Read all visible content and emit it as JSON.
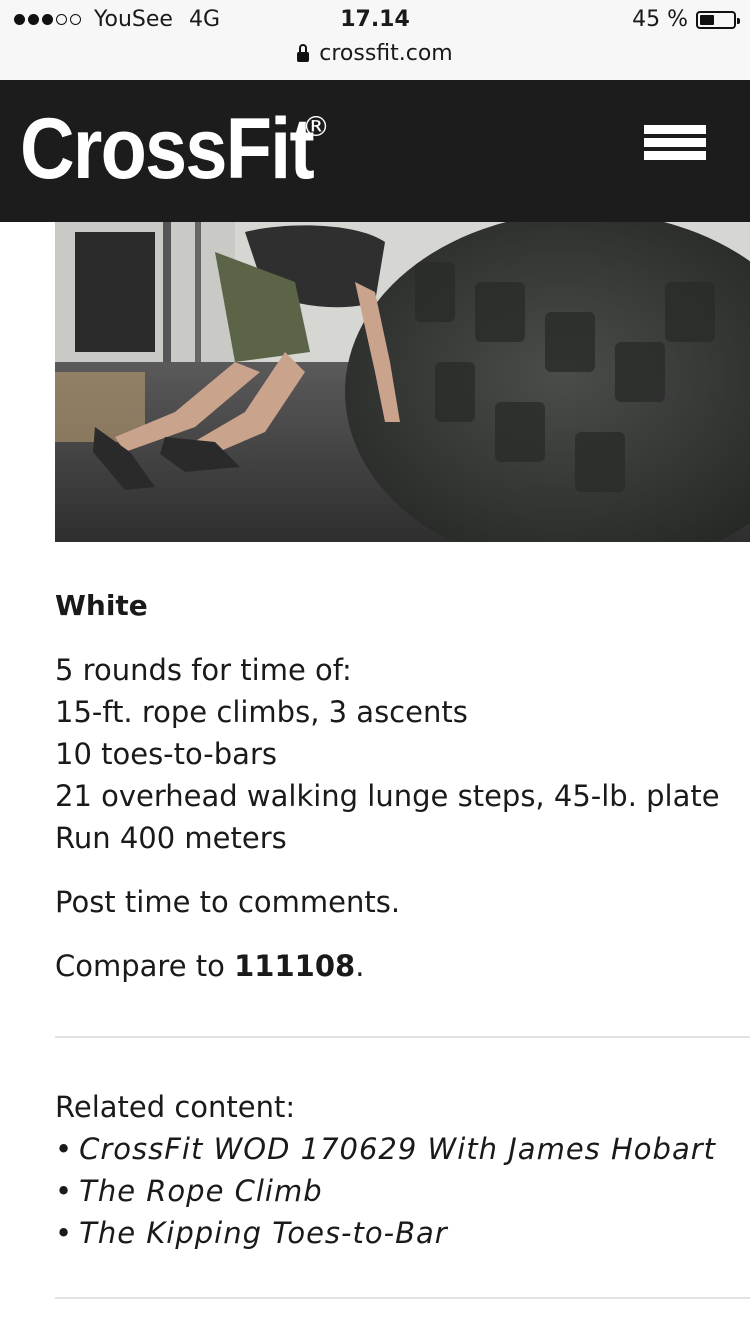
{
  "status_bar": {
    "carrier": "YouSee",
    "network": "4G",
    "time": "17.14",
    "battery": "45 %",
    "battery_level": 0.45,
    "url": "crossfit.com"
  },
  "header": {
    "logo_text": "CrossFit",
    "registered_mark": "®",
    "menu_icon": "hamburger-menu-icon"
  },
  "hero": {
    "icon": "tire-flip-photo"
  },
  "workout": {
    "title": "White",
    "lines": [
      "5 rounds for time of:",
      "15-ft. rope climbs, 3 ascents",
      "10 toes-to-bars",
      "21 overhead walking lunge steps, 45-lb. plate",
      "Run 400 meters"
    ],
    "post_text": "Post time to comments.",
    "compare_prefix": "Compare to ",
    "compare_value": "111108",
    "compare_suffix": "."
  },
  "related": {
    "heading": "Related content:",
    "items": [
      "CrossFit WOD 170629 With James Hobart",
      "The Rope Climb",
      "The Kipping Toes-to-Bar"
    ]
  }
}
